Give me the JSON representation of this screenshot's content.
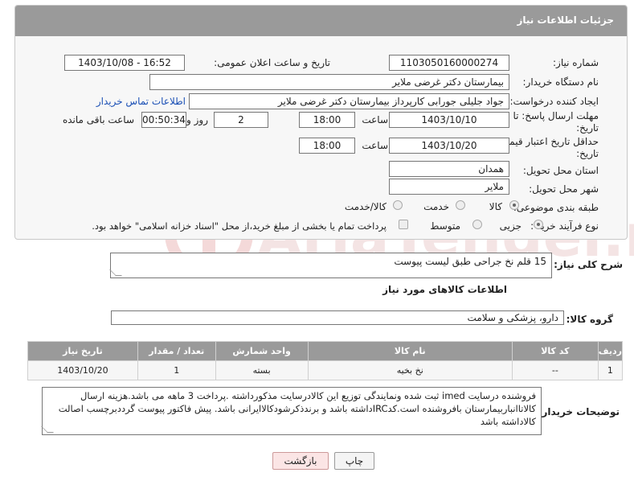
{
  "header": {
    "title": "جزئیات اطلاعات نیاز"
  },
  "fields": {
    "need_number_label": "شماره نیاز:",
    "need_number": "1103050160000274",
    "announce_label": "تاریخ و ساعت اعلان عمومی:",
    "announce_value": "1403/10/08 - 16:52",
    "buyer_org_label": "نام دستگاه خریدار:",
    "buyer_org": "بیمارستان دکتر غرضی ملایر",
    "creator_label": "ایجاد کننده درخواست:",
    "creator": "جواد جلیلی جورابی کارپرداز بیمارستان دکتر غرضی ملایر",
    "contact_link": "اطلاعات تماس خریدار",
    "deadline_label_1": "مهلت ارسال پاسخ: تا",
    "deadline_label_2": "تاریخ:",
    "deadline_date": "1403/10/10",
    "time_label": "ساعت",
    "deadline_time": "18:00",
    "days_value": "2",
    "days_label": "روز و",
    "remaining_time": "00:50:34",
    "remaining_label": "ساعت باقی مانده",
    "validity_label_1": "حداقل تاریخ اعتبار قیمت: تا",
    "validity_label_2": "تاریخ:",
    "validity_date": "1403/10/20",
    "validity_time_label": "ساعت",
    "validity_time": "18:00",
    "province_label": "استان محل تحویل:",
    "province": "همدان",
    "city_label": "شهر محل تحویل:",
    "city": "ملایر",
    "category_label": "طبقه بندی موضوعی:",
    "category_options": [
      "کالا",
      "خدمت",
      "کالا/خدمت"
    ],
    "purchase_label": "نوع فرآیند خرید :",
    "purchase_options": [
      "جزیی",
      "متوسط"
    ],
    "payment_note": "پرداخت تمام یا بخشی از مبلغ خرید،از محل \"اسناد خزانه اسلامی\" خواهد بود."
  },
  "description": {
    "label": "شرح کلی نیاز:",
    "value": "15 قلم نخ جراحی طبق لیست پیوست"
  },
  "goods_info": {
    "title": "اطلاعات کالاهای مورد نیاز",
    "group_label": "گروه کالا:",
    "group_value": "دارو، پزشکی و سلامت"
  },
  "table": {
    "headers": [
      "ردیف",
      "کد کالا",
      "نام کالا",
      "واحد شمارش",
      "تعداد / مقدار",
      "تاریخ نیاز"
    ],
    "rows": [
      [
        "1",
        "--",
        "نخ بخیه",
        "بسته",
        "1",
        "1403/10/20"
      ]
    ]
  },
  "buyer_notes": {
    "label": "توضیحات خریدار:",
    "value": "فروشنده درسایت imed ثبت شده ونمایندگی توزیع این کالادرسایت مذکورداشته .پرداخت 3 ماهه می باشد.هزینه ارسال کالاتاانباربیمارستان بافروشنده است.کدIRCداشته باشد و برندذکرشودکالاایرانی باشد. پیش فاکتور پیوست گرددبرچسب اصالت کالاداشته باشد"
  },
  "buttons": {
    "print": "چاپ",
    "back": "بازگشت"
  },
  "watermark": {
    "text": "AriaTender.neT"
  },
  "colors": {
    "header_bg": "#9a9a9a",
    "link": "#1a4fb5",
    "watermark": "#e9b3b3"
  }
}
